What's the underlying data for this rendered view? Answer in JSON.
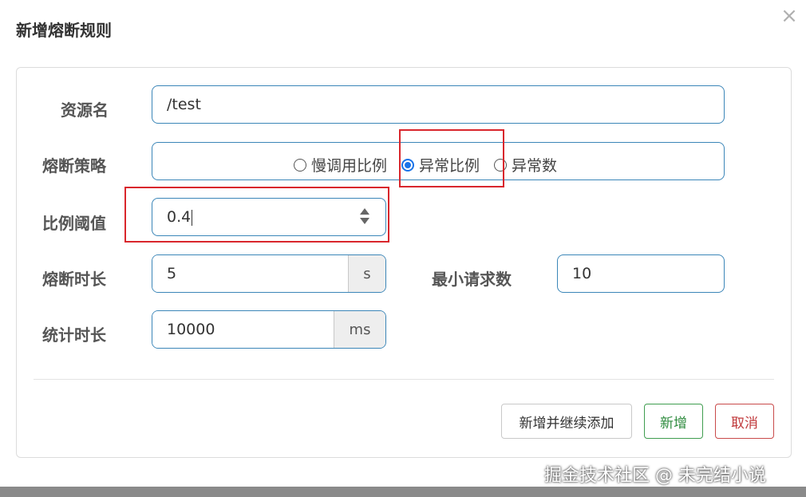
{
  "dialog": {
    "title": "新增熔断规则",
    "close_icon": "×"
  },
  "form": {
    "resource": {
      "label": "资源名",
      "value": "/test"
    },
    "strategy": {
      "label": "熔断策略",
      "options": [
        {
          "label": "慢调用比例",
          "checked": false
        },
        {
          "label": "异常比例",
          "checked": true
        },
        {
          "label": "异常数",
          "checked": false
        }
      ]
    },
    "ratio": {
      "label": "比例阈值",
      "value": "0.4"
    },
    "duration": {
      "label": "熔断时长",
      "value": "5",
      "unit": "s"
    },
    "min_requests": {
      "label": "最小请求数",
      "value": "10"
    },
    "stat_duration": {
      "label": "统计时长",
      "value": "10000",
      "unit": "ms"
    }
  },
  "footer": {
    "add_continue": "新增并继续添加",
    "add": "新增",
    "cancel": "取消"
  },
  "watermark": "掘金技术社区 @ 未完结小说",
  "colors": {
    "accent": "#1a73e8",
    "highlight": "#d9262c",
    "add_green": "#2e8b3e",
    "cancel_red": "#c0393b"
  }
}
